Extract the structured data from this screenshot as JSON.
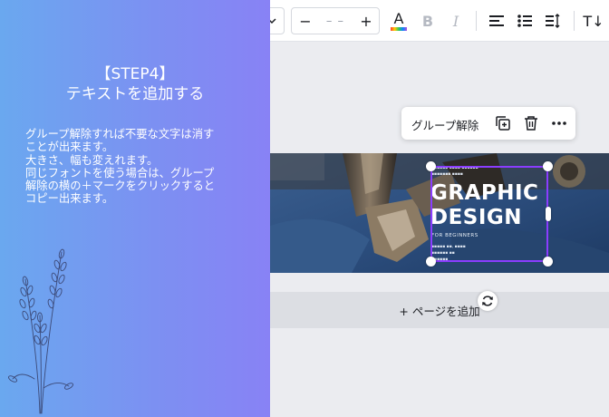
{
  "toolbar": {
    "minus_label": "−",
    "size_value": "– –",
    "plus_label": "+",
    "text_color_icon": "text-color-icon",
    "bold_label": "B",
    "italic_label": "I",
    "text_size_label": "T↓"
  },
  "tutorial": {
    "step_title": "【STEP4】",
    "step_subtitle": "テキストを追加する",
    "lines": [
      "グループ解除すれば不要な文字は消す",
      "ことが出来ます。",
      "大きさ、幅も変えれます。",
      "同じフォントを使う場合は、グループ",
      "解除の横の＋マークをクリックすると",
      "コピー出来ます。"
    ]
  },
  "context_menu": {
    "ungroup_label": "グループ解除",
    "icons": [
      "duplicate-icon",
      "trash-icon",
      "more-icon"
    ]
  },
  "design": {
    "title_line1": "GRAPHIC",
    "title_line2": "DESIGN",
    "subtitle": "FOR BEGINNERS"
  },
  "add_page": {
    "label": "+ ページを追加"
  },
  "colors": {
    "panel_start": "#6aa8ef",
    "panel_end": "#8882f5",
    "selection": "#8b3dff",
    "add_page_bg": "#dcdee3"
  }
}
